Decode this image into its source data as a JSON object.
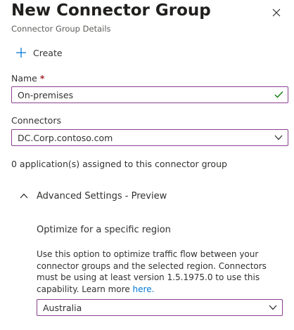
{
  "panel": {
    "title": "New Connector Group",
    "subtitle": "Connector Group Details",
    "close_icon": "close-icon"
  },
  "toolbar": {
    "create_label": "Create",
    "create_icon": "plus-icon"
  },
  "name_field": {
    "label": "Name",
    "required_marker": "*",
    "value": "On-premises",
    "valid_icon": "checkmark-icon"
  },
  "connectors_field": {
    "label": "Connectors",
    "selected": "DC.Corp.contoso.com"
  },
  "assignment_info": "0 application(s) assigned to this connector group",
  "advanced": {
    "label": "Advanced Settings - Preview",
    "expanded": true,
    "region_title": "Optimize for a specific region",
    "description": "Use this option to optimize traffic flow between your connector groups and the selected region. Connectors must be using at least version 1.5.1975.0 to use this capability. Learn more",
    "learn_more_link": "here.",
    "region_selected": "Australia"
  },
  "colors": {
    "accent_border": "#8a3f8f",
    "link": "#0078d4",
    "success": "#107c10",
    "required": "#a4262c",
    "plus_icon": "#0078d4"
  }
}
